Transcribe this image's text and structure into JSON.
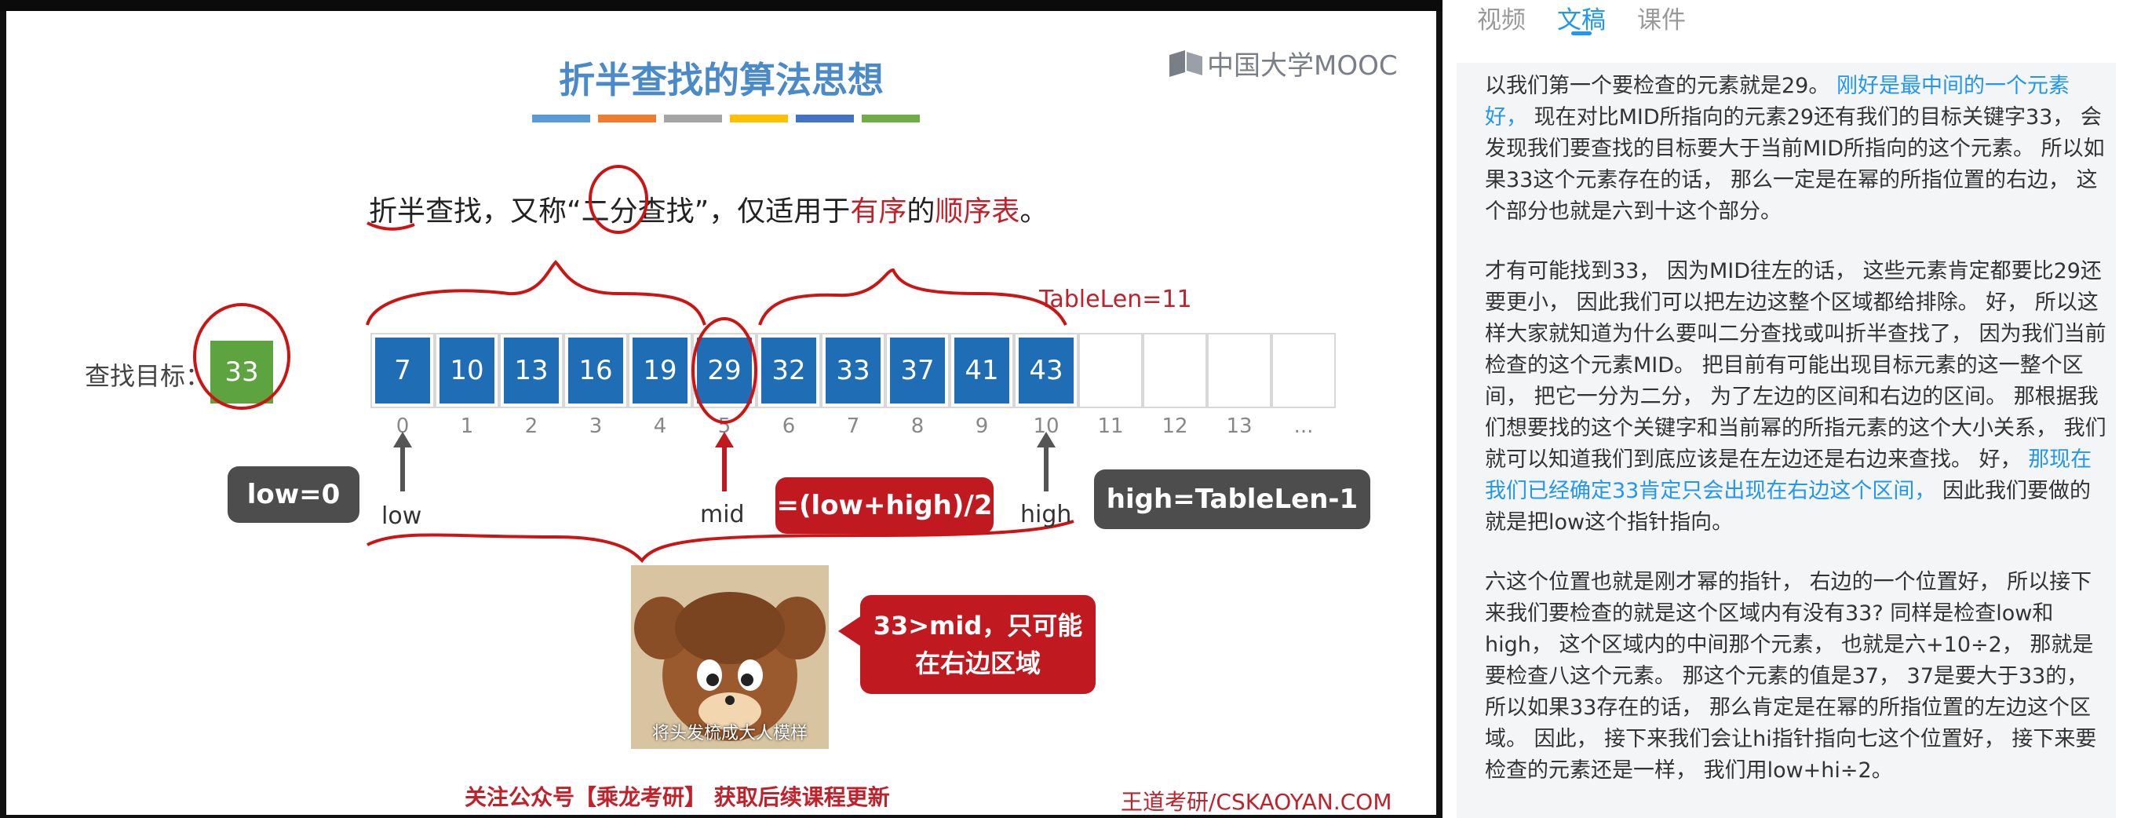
{
  "slide": {
    "title": "折半查找的算法思想",
    "brand": "中国大学MOOC",
    "sentence": {
      "part1": "折半查找，又称“二分查找”，仅适用于",
      "word1": "有序",
      "part2": "的",
      "word2": "顺序表",
      "part3": "。"
    },
    "target_label": "查找目标：",
    "target_value": "33",
    "array": [
      "7",
      "10",
      "13",
      "16",
      "19",
      "29",
      "32",
      "33",
      "37",
      "41",
      "43",
      "",
      "",
      "",
      ""
    ],
    "indices": [
      "0",
      "1",
      "2",
      "3",
      "4",
      "5",
      "6",
      "7",
      "8",
      "9",
      "10",
      "11",
      "12",
      "13",
      "..."
    ],
    "tablelen": "TableLen=11",
    "low_callout": "low=0",
    "low_label": "low",
    "mid_label": "mid",
    "mid_callout": "=(low+high)/2",
    "high_label": "high",
    "high_callout": "high=TableLen-1",
    "meme_caption": "将头发梳成大人模样",
    "meme_callout_line1": "33>mid，只可能",
    "meme_callout_line2": "在右边区域",
    "footer_ad": "关注公众号【乘龙考研】 获取后续课程更新",
    "footer_site": "王道考研/CSKAOYAN.COM",
    "colors": {
      "blue_cell": "#1f6db5",
      "green_target": "#5da33f",
      "accent_red": "#c0212b",
      "title_blue": "#4a8ac9"
    }
  },
  "panel": {
    "tabs": [
      "视频",
      "文稿",
      "课件"
    ],
    "active_tab": "文稿",
    "p1": {
      "a": "以我们第一个要检查的元素就是29。",
      "b": "刚好是最中间的一个元素好，",
      "c": "现在对比MID所指向的元素29还有我们的目标关键字33， 会发现我们要查找的目标要大于当前MID所指向的这个元素。 所以如果33这个元素存在的话， 那么一定是在幂的所指位置的右边， 这个部分也就是六到十这个部分。"
    },
    "p2": {
      "a": "才有可能找到33， 因为MID往左的话， 这些元素肯定都要比29还要更小， 因此我们可以把左边这整个区域都给排除。 好， 所以这样大家就知道为什么要叫二分查找或叫折半查找了， 因为我们当前检查的这个元素MID。 把目前有可能出现目标元素的这一整个区间， 把它一分为二分， 为了左边的区间和右边的区间。 那根据我们想要找的这个关键字和当前幂的所指元素的这个大小关系， 我们就可以知道我们到底应该是在左边还是右边来查找。 好，",
      "b": "那现在我们已经确定33肯定只会出现在右边这个区间，",
      "c": "因此我们要做的就是把low这个指针指向。"
    },
    "p3": "六这个位置也就是刚才幂的指针， 右边的一个位置好， 所以接下来我们要检查的就是这个区域内有没有33? 同样是检查low和high， 这个区域内的中间那个元素， 也就是六+10÷2， 那就是要检查八这个元素。 那这个元素的值是37， 37是要大于33的， 所以如果33存在的话， 那么肯定是在幂的所指位置的左边这个区域。 因此， 接下来我们会让hi指针指向七这个位置好， 接下来要检查的元素还是一样， 我们用low+hi÷2。"
  }
}
